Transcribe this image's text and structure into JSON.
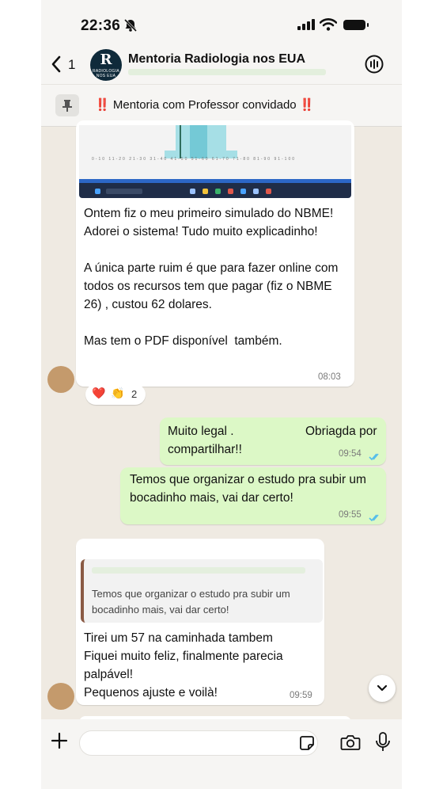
{
  "status_bar": {
    "time": "22:36"
  },
  "header": {
    "back_count": "1",
    "avatar_letter": "R",
    "avatar_sub": "RADIOLOGIA NOS EUA",
    "title": "Mentoria Radiologia nos EUA"
  },
  "pinned": {
    "prefix": "‼️",
    "text": "Mentoria com Professor convidado",
    "suffix": "‼️"
  },
  "image_preview": {
    "axis_labels": "0-10 11-20 21-30 31-40 41-50 51-60 61-70 71-80 81-90 91-100"
  },
  "messages": [
    {
      "direction": "incoming",
      "text": "Ontem fiz o meu primeiro simulado do NBME! Adorei o sistema! Tudo muito explicadinho!\n\nA única parte ruim é que para fazer online com todos os recursos tem que pagar (fiz o NBME 26) , custou 62 dolares.\n\nMas tem o PDF disponível  também.",
      "time": "08:03",
      "reactions": {
        "emojis": [
          "❤️",
          "👏"
        ],
        "count": "2"
      }
    },
    {
      "direction": "outgoing",
      "text": "Muito legal .                     Obriagda por compartilhar!!",
      "time": "09:54",
      "status": "read"
    },
    {
      "direction": "outgoing",
      "text": "Temos que organizar o estudo pra subir um bocadinho mais, vai dar certo!",
      "time": "09:55",
      "status": "read"
    },
    {
      "direction": "incoming",
      "quote": "Temos que organizar o estudo pra subir um bocadinho mais, vai dar certo!",
      "text": "Tirei um 57 na caminhada tambem\nFiquei muito feliz, finalmente parecia palpável!\nPequenos ajuste e voilà!",
      "time": "09:59"
    }
  ],
  "composer": {
    "value": "",
    "placeholder": ""
  },
  "colors": {
    "chat_bg": "#efeae2",
    "outgoing_bubble": "#dcf8c6",
    "incoming_bubble": "#ffffff",
    "read_ticks": "#53bdeb",
    "alert_red": "#e02020"
  },
  "icons": [
    "bell-slash-icon",
    "signal-icon",
    "wifi-icon",
    "battery-icon",
    "chevron-left-icon",
    "call-icon",
    "pin-icon",
    "double-check-icon",
    "chevron-down-icon",
    "plus-icon",
    "sticker-icon",
    "camera-icon",
    "mic-icon"
  ]
}
